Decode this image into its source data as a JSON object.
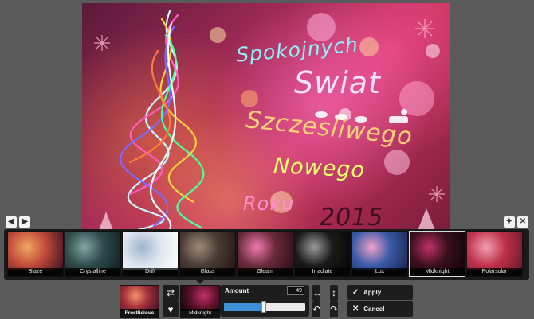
{
  "canvas": {
    "greeting_lines": [
      "Spokojnych",
      "Swiat",
      "Szczesliwego",
      "Nowego",
      "Roku",
      "2015"
    ]
  },
  "toolbar_top": {
    "back_icon": "arrow-left-icon",
    "forward_icon": "arrow-right-icon",
    "pin_icon": "pin-icon",
    "close_icon": "close-icon"
  },
  "effects": {
    "items": [
      {
        "label": "Blaze",
        "colors": [
          "#c04a3a",
          "#f0a860",
          "#3a1020"
        ]
      },
      {
        "label": "Crystalline",
        "colors": [
          "#2f4a4a",
          "#7fa6a0",
          "#10201f"
        ]
      },
      {
        "label": "Drift",
        "colors": [
          "#dde6f0",
          "#9fb4cc",
          "#ffffff"
        ]
      },
      {
        "label": "Glass",
        "colors": [
          "#4a3c34",
          "#a08a78",
          "#20160f"
        ]
      },
      {
        "label": "Gleam",
        "colors": [
          "#6a2a3a",
          "#f07ab0",
          "#2a0f1a"
        ]
      },
      {
        "label": "Irradiate",
        "colors": [
          "#1a1a1a",
          "#9a9a9a",
          "#050505"
        ]
      },
      {
        "label": "Lux",
        "colors": [
          "#3a5aa8",
          "#f0a0c8",
          "#1a2450"
        ]
      },
      {
        "label": "Midknight",
        "colors": [
          "#3a0f1c",
          "#c0306a",
          "#100509"
        ]
      },
      {
        "label": "Polarsolar",
        "colors": [
          "#c0304a",
          "#f0a0b0",
          "#6a1828"
        ]
      }
    ]
  },
  "panel": {
    "current_effect_label": "Frostlicious",
    "selected_effect_label": "Midknight",
    "amount_label": "Amount",
    "amount_value": "49",
    "amount_fraction": 0.49,
    "apply_label": "Apply",
    "cancel_label": "Cancel",
    "shuffle_icon": "shuffle-icon",
    "favorite_icon": "heart-icon",
    "flip_h_icon": "flip-horizontal-icon",
    "flip_v_icon": "flip-vertical-icon",
    "undo_icon": "rotate-left-icon",
    "redo_icon": "rotate-right-icon",
    "apply_icon": "check-icon",
    "cancel_icon": "x-icon"
  },
  "colors": {
    "background": "#5a5a5a",
    "panel": "#1d1d1d",
    "accent": "#3d8fd8"
  }
}
